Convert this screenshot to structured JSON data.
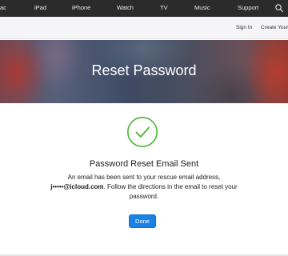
{
  "globalnav": {
    "items": [
      "ac",
      "iPad",
      "iPhone",
      "Watch",
      "TV",
      "Music",
      "Support"
    ],
    "search_icon": "search-icon"
  },
  "subnav": {
    "sign_in": "Sign In",
    "create": "Create Your A"
  },
  "hero": {
    "title": "Reset Password"
  },
  "confirmation": {
    "icon": "checkmark-circle-icon",
    "icon_color": "#48b632",
    "heading": "Password Reset Email Sent",
    "body_line1": "An email has been sent to your rescue email address,",
    "email": "j•••••@icloud.com",
    "body_line2": ". Follow the directions in the email to reset your password.",
    "done_label": "Done"
  },
  "colors": {
    "nav_bg": "#2b2b2b",
    "button": "#1a82e2"
  }
}
